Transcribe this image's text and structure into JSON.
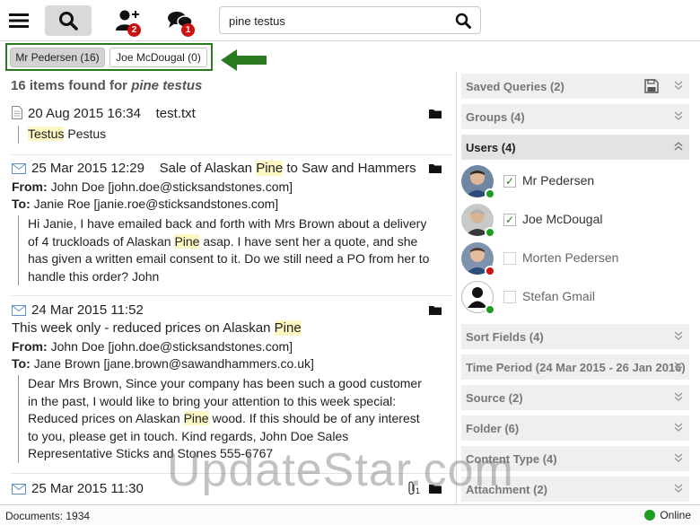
{
  "toolbar": {
    "menu_icon": "hamburger-icon",
    "search_icon": "magnifier-icon",
    "users_icon": "add-user-icon",
    "users_badge": "2",
    "chat_icon": "chat-bubbles-icon",
    "chat_badge": "1"
  },
  "search": {
    "value": "pine testus"
  },
  "user_filter": {
    "chips": [
      "Mr Pedersen (16)",
      "Joe McDougal (0)"
    ]
  },
  "results": {
    "found_prefix": "16 items found for ",
    "found_query": "pine testus",
    "items": [
      {
        "date": "20 Aug 2015 16:34",
        "title": "test.txt",
        "snippet_hl": "Testus",
        "snippet_rest": " Pestus"
      },
      {
        "date": "25 Mar 2015 12:29",
        "title_pre": "Sale of Alaskan ",
        "title_hl": "Pine",
        "title_post": " to Saw and Hammers",
        "from_label": "From:",
        "from": "John Doe [john.doe@sticksandstones.com]",
        "to_label": "To:",
        "to": "Janie Roe [janie.roe@sticksandstones.com]",
        "body_pre": "Hi Janie, I have emailed back and forth with Mrs Brown about a delivery of 4 truckloads of Alaskan ",
        "body_hl": "Pine",
        "body_post": " asap. I have sent her a quote, and she has given a written email consent to it. Do we still need a PO from her to handle this order? John"
      },
      {
        "date": "24 Mar 2015 11:52",
        "title_pre": "This week only - reduced prices on Alaskan ",
        "title_hl": "Pine",
        "from_label": "From:",
        "from": "John Doe [john.doe@sticksandstones.com]",
        "to_label": "To:",
        "to": "Jane Brown [jane.brown@sawandhammers.co.uk]",
        "body_pre": "Dear Mrs Brown, Since your company has been such a good customer in the past, I would like to bring your attention to this week special: Reduced prices on Alaskan ",
        "body_hl": "Pine",
        "body_post": " wood. If this should be of any interest to you, please get in touch. Kind regards, John Doe Sales Representative Sticks and Stones 555-6767"
      },
      {
        "date": "25 Mar 2015 11:30",
        "attachment_count": "1"
      }
    ]
  },
  "panel": {
    "saved_queries": "Saved Queries (2)",
    "groups": "Groups (4)",
    "users": "Users (4)",
    "user_list": [
      {
        "name": "Mr Pedersen",
        "checked": true,
        "status": "online"
      },
      {
        "name": "Joe McDougal",
        "checked": true,
        "status": "online"
      },
      {
        "name": "Morten Pedersen",
        "checked": false,
        "status": "busy"
      },
      {
        "name": "Stefan Gmail",
        "checked": false,
        "status": "online"
      }
    ],
    "sort_fields": "Sort Fields (4)",
    "time_period": "Time Period (24 Mar 2015 - 26 Jan 2016)",
    "source": "Source (2)",
    "folder": "Folder (6)",
    "content_type": "Content Type (4)",
    "attachment": "Attachment (2)"
  },
  "status": {
    "documents": "Documents: 1934",
    "online": "Online"
  },
  "watermark": "UpdateStar.com",
  "colors": {
    "highlight": "#fcf6c2",
    "badge_red": "#d01010",
    "online_green": "#1e9c1e",
    "arrow_green": "#2a7a1f"
  }
}
